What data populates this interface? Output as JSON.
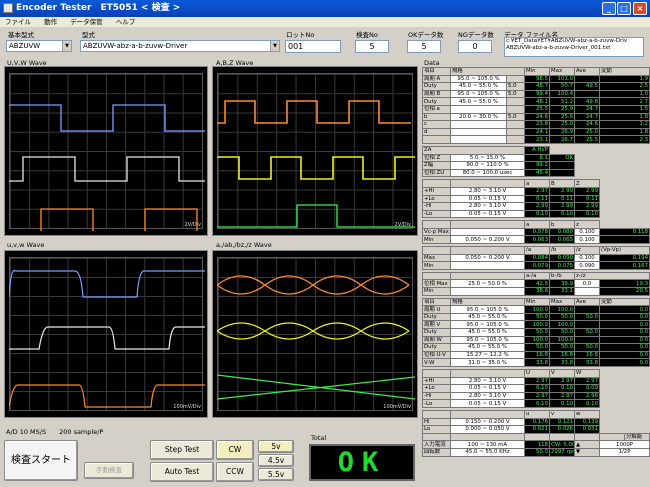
{
  "window": {
    "title": "Encoder Tester　ET5051 < 検査 >"
  },
  "menu": [
    "ファイル",
    "動作",
    "データ保管",
    "ヘルプ"
  ],
  "header": {
    "basic_type_label": "基本型式",
    "basic_type_value": "ABZUVW",
    "model_label": "型式",
    "model_value": "ABZUVW-abz-a-b-zuvw-Driver",
    "lot_label": "ロットNo",
    "lot_value": "001",
    "inspect_label": "検査No",
    "inspect_value": "5",
    "ok_label": "OKデータ数",
    "ok_value": "5",
    "ng_label": "NGデータ数",
    "ng_value": "0",
    "file_label": "データ ファイル名",
    "file_lines": [
      "c:¥ET_Data¥ET¥ABZUVW-abz-a-b-zuvw-Driv",
      "ABZUVW-abz-a-b-zuvw-Driver_001.txt"
    ]
  },
  "waves": {
    "uvw": "U,V,W Wave",
    "abz": "A,B,Z Wave",
    "uvw_inv": "u,v,w Wave",
    "ab_inv": "a,/ab,/bz,/z Wave"
  },
  "scales": {
    "uvw": "2V/Div",
    "abz": "2V/Div",
    "uvw_inv": "100mV/Div",
    "ab_inv": "100mV/Div"
  },
  "sampling": "A/D 10 MS/S　　200 sample/P",
  "data": {
    "title": "Data",
    "header": [
      "項目",
      "規格",
      "Min",
      "Max",
      "Ave",
      "変動"
    ],
    "rows": [
      [
        "周期 A",
        "95.0 ~ 105.0 %",
        "",
        "98.5",
        "101.0",
        "",
        "1.9"
      ],
      [
        "Duty",
        "45.0 ~ 55.0 %",
        "5.0",
        "48.7",
        "50.7",
        "49.5",
        "2.5"
      ],
      [
        "周期 B",
        "95.0 ~ 105.0 %",
        "5.0",
        "99.4",
        "100.4",
        "",
        "1.0"
      ],
      [
        "Duty",
        "45.0 ~ 55.0 %",
        "",
        "48.1",
        "51.2",
        "49.8",
        "2.7"
      ],
      [
        "位相 a",
        "",
        "",
        "23.5",
        "25.9",
        "24.7",
        "1.5"
      ],
      [
        "b",
        "20.0 ~ 30.0 %",
        "5.0",
        "24.6",
        "25.5",
        "24.7",
        "1.8"
      ],
      [
        "c",
        "",
        "",
        "23.8",
        "25.0",
        "24.6",
        "1.2"
      ],
      [
        "d",
        "",
        "",
        "24.1",
        "26.9",
        "25.0",
        "1.8"
      ],
      [
        "",
        "",
        "",
        "23.1",
        "26.7",
        "25.5",
        "2.3"
      ]
    ],
    "za_header": [
      "ZA",
      "A Hi/P"
    ],
    "za_rows": [
      [
        "位相 Z",
        "5.0 ~ 15.0 %",
        "8.1",
        "OK"
      ],
      [
        "Z幅",
        "90.0 ~ 110.0 %",
        "99.2",
        ""
      ],
      [
        "位相 ZU",
        "80.0 ~ 100.0 usec",
        "45.4",
        ""
      ]
    ],
    "ab_header": [
      "",
      "",
      "a",
      "B",
      "Z"
    ],
    "ab_rows": [
      [
        "+Hi",
        "2.80 ~ 3.10 V",
        "2.97",
        "2.99",
        "2.99"
      ],
      [
        "+Lo",
        "0.05 ~ 0.15 V",
        "0.11",
        "0.11",
        "0.11"
      ],
      [
        "-Hi",
        "2.80 ~ 3.10 V",
        "2.99",
        "2.99",
        "2.99"
      ],
      [
        "-Lo",
        "0.05 ~ 0.15 V",
        "0.10",
        "0.10",
        "0.10"
      ]
    ],
    "vpp_header": [
      "",
      "",
      "a",
      "b",
      "z"
    ],
    "vpp_rows": [
      [
        "Vc-p Max",
        "",
        "0.078",
        "0.080",
        "0.100",
        "0.118"
      ],
      [
        "Min",
        "0.050 ~ 0.200 V",
        "0.063",
        "0.065",
        "0.100",
        ""
      ]
    ],
    "vpp2_header": [
      "/a",
      "/b",
      "/z",
      "(Vp-Vp)"
    ],
    "vpp2_rows": [
      [
        "Max",
        "0.050 ~ 0.200 V",
        "0.084",
        "0.090",
        "0.100",
        "0.194"
      ],
      [
        "Min",
        "",
        "0.079",
        "0.075",
        "0.090",
        "0.167"
      ]
    ],
    "phase_header": [
      "a-/a",
      "b-/b",
      "z-/z"
    ],
    "phase_rows": [
      [
        "位相 Max",
        "25.0 ~ 50.0 %",
        "42.5",
        "39.9",
        "0.0",
        "19.3"
      ],
      [
        "Min",
        "",
        "38.8",
        "33.1",
        "",
        "20.5"
      ]
    ],
    "header2": [
      "項目",
      "規格",
      "Min",
      "Max",
      "Ave",
      "変動"
    ],
    "rows2": [
      [
        "周期 U",
        "95.0 ~ 105.0 %",
        "100.0",
        "100.0",
        "",
        "0.0"
      ],
      [
        "Duty",
        "45.0 ~ 55.0 %",
        "50.0",
        "50.0",
        "50.0",
        "0.0"
      ],
      [
        "周期 V",
        "95.0 ~ 105.0 %",
        "100.0",
        "100.0",
        "",
        "0.0"
      ],
      [
        "Duty",
        "45.0 ~ 55.0 %",
        "50.0",
        "50.0",
        "50.0",
        "0.0"
      ],
      [
        "周期 W",
        "95.0 ~ 105.0 %",
        "100.0",
        "100.0",
        "",
        "0.0"
      ],
      [
        "Duty",
        "45.0 ~ 55.0 %",
        "50.0",
        "50.0",
        "50.0",
        "0.0"
      ],
      [
        "位相 U-V",
        "15.27 ~ 12.2 %",
        "16.8",
        "16.8",
        "16.8",
        "0.0"
      ],
      [
        "V-W",
        "31.0 ~ 35.0 %",
        "33.8",
        "33.8",
        "33.8",
        "0.0"
      ]
    ],
    "uvw_header": [
      "",
      "",
      "U",
      "V",
      "W"
    ],
    "uvw_rows": [
      [
        "+Hi",
        "2.80 ~ 3.10 V",
        "2.97",
        "2.97",
        "2.97"
      ],
      [
        "+Lo",
        "0.05 ~ 0.15 V",
        "0.10",
        "0.10",
        "0.09"
      ],
      [
        "-Hi",
        "2.80 ~ 3.10 V",
        "2.97",
        "2.97",
        "2.96"
      ],
      [
        "-Lo",
        "0.05 ~ 0.15 V",
        "0.10",
        "0.10",
        "0.10"
      ]
    ],
    "uvw2_header": [
      "u",
      "v",
      "w"
    ],
    "uvw2_rows": [
      [
        "Hi",
        "0.150 ~ 0.200 V",
        "0.176",
        "0.121",
        "0.139"
      ],
      [
        "Lo",
        "0.000 ~ 0.050 V",
        "0.021",
        "0.026",
        "0.031"
      ]
    ],
    "foot": [
      [
        "入力電流",
        "100 ~ 130 mA",
        "118",
        "CW: 5.00 V",
        "▲",
        "1000P"
      ],
      [
        "回転数",
        "45.0 ~ 55.0 KHz",
        "50.0",
        "2997 rpm",
        "▼",
        "1/2P"
      ]
    ],
    "foot_label": "分解能"
  },
  "controls": {
    "start": "検査スタート",
    "manual": "手動検査",
    "step_test": "Step Test",
    "auto_test": "Auto Test",
    "cw": "CW",
    "ccw": "CCW",
    "v5": "5v",
    "v45": "4.5v",
    "v55": "5.5v",
    "total_label": "Total",
    "total_value": "OK"
  }
}
